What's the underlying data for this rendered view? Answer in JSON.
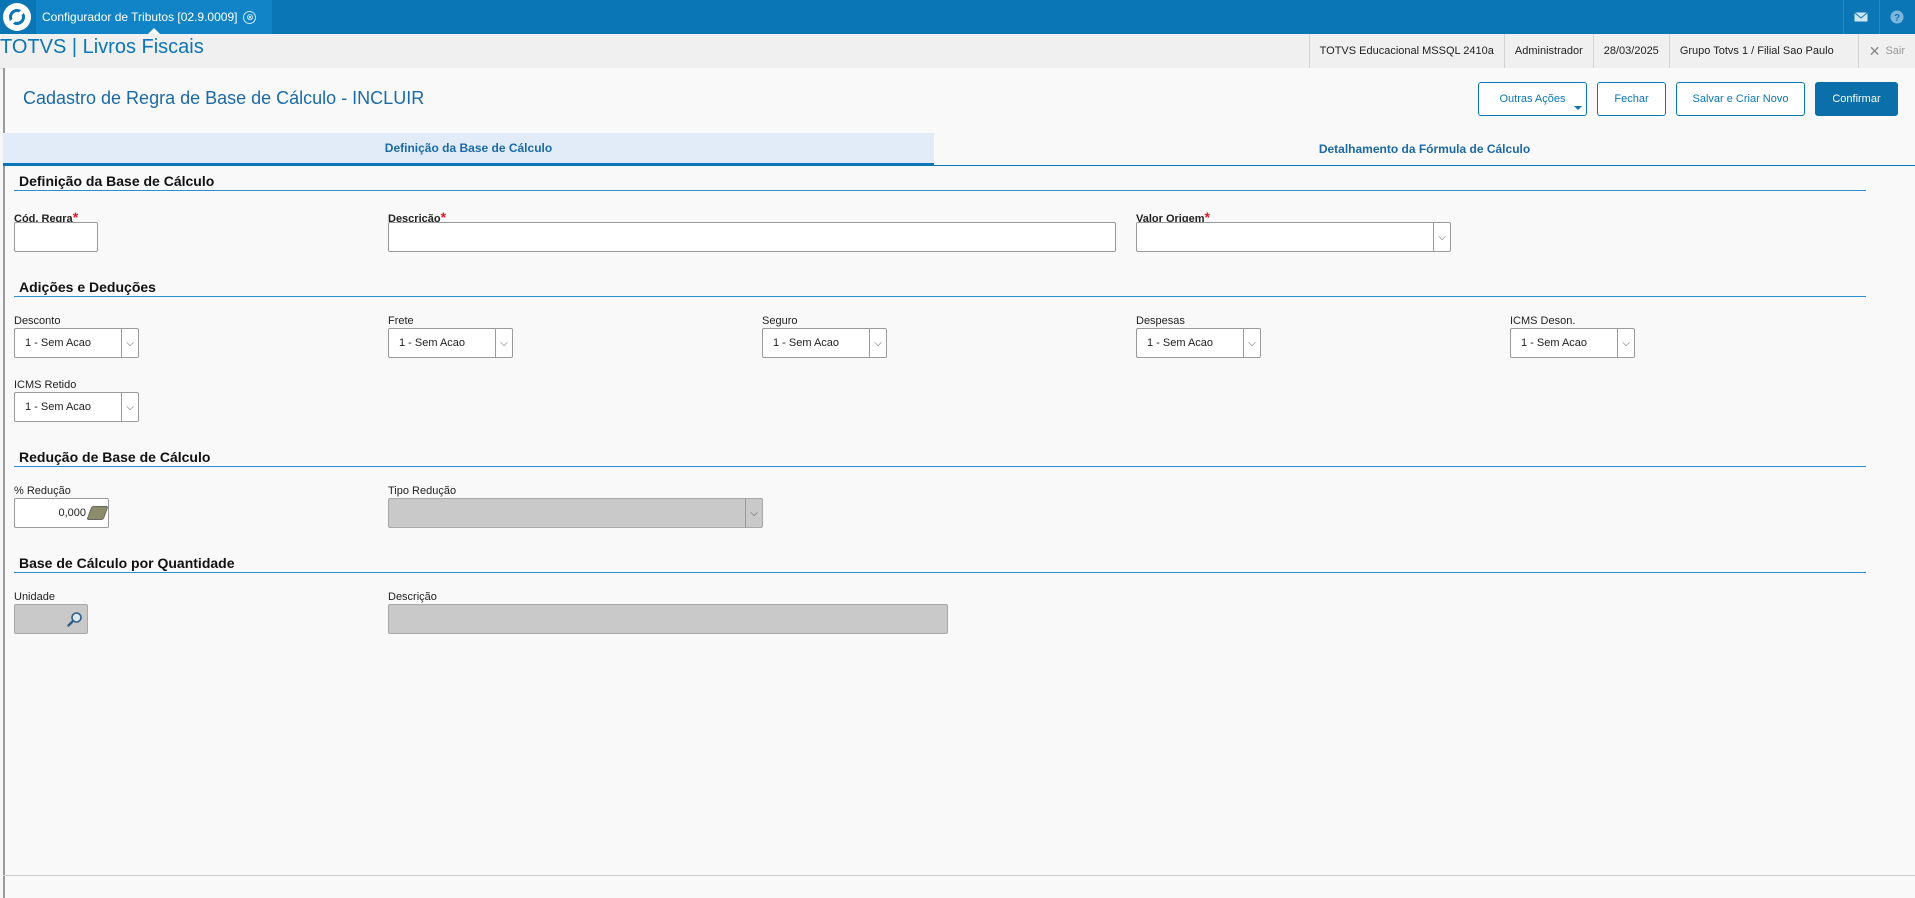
{
  "topbar": {
    "tab_title": "Configurador de Tributos [02.9.0009]",
    "tab_close": "⊗",
    "mail_icon": "mail-icon",
    "help_icon": "help-icon"
  },
  "header": {
    "brand": "TOTVS | Livros Fiscais",
    "environment": "TOTVS Educacional MSSQL 2410a",
    "user": "Administrador",
    "date": "28/03/2025",
    "branch": "Grupo Totvs 1 / Filial Sao Paulo",
    "logout": "Sair"
  },
  "page": {
    "title": "Cadastro de Regra de Base de Cálculo - INCLUIR"
  },
  "actions": {
    "other": "Outras Ações",
    "close": "Fechar",
    "save_new": "Salvar e Criar Novo",
    "confirm": "Confirmar"
  },
  "tabs": [
    {
      "label": "Definição da Base de Cálculo",
      "active": true
    },
    {
      "label": "Detalhamento da Fórmula de Cálculo",
      "active": false
    }
  ],
  "sections": {
    "definicao": {
      "title": "Definição da Base de Cálculo",
      "cod_regra_label": "Cód. Regra",
      "cod_regra_value": "",
      "descricao_label": "Descrição",
      "descricao_value": "",
      "valor_origem_label": "Valor Origem",
      "valor_origem_value": "",
      "required_mark": "*"
    },
    "adicoes": {
      "title": "Adições e Deduções",
      "desconto_label": "Desconto",
      "desconto_value": "1 - Sem Acao",
      "frete_label": "Frete",
      "frete_value": "1 - Sem Acao",
      "seguro_label": "Seguro",
      "seguro_value": "1 - Sem Acao",
      "despesas_label": "Despesas",
      "despesas_value": "1 - Sem Acao",
      "icms_deson_label": "ICMS Deson.",
      "icms_deson_value": "1 - Sem Acao",
      "icms_retido_label": "ICMS Retido",
      "icms_retido_value": "1 - Sem Acao"
    },
    "reducao": {
      "title": "Redução de Base de Cálculo",
      "perc_label": "% Redução",
      "perc_value": "0,000",
      "tipo_label": "Tipo Redução",
      "tipo_value": ""
    },
    "quantidade": {
      "title": "Base de Cálculo por Quantidade",
      "unidade_label": "Unidade",
      "unidade_value": "",
      "descricao_label": "Descrição",
      "descricao_value": ""
    }
  },
  "colors": {
    "primary": "#0b76b6",
    "required": "#e0192b",
    "disabled": "#c9c9c9"
  }
}
